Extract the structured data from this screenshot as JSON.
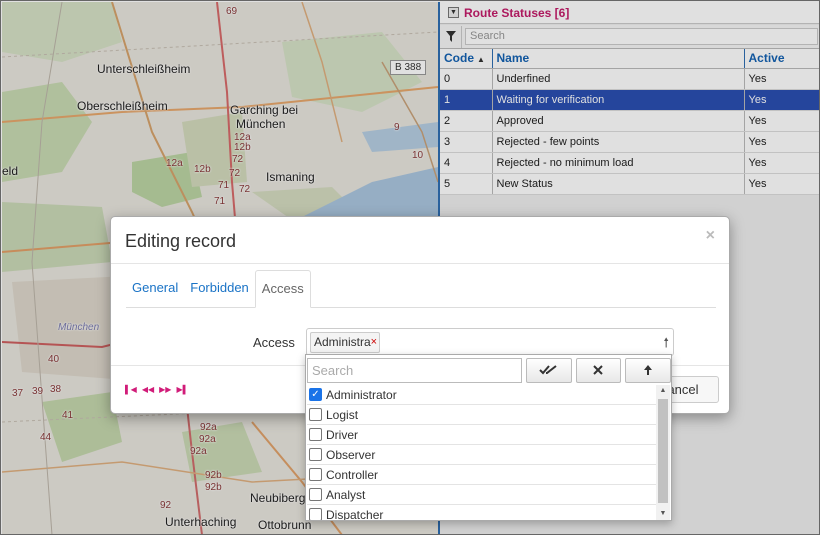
{
  "map": {
    "labels": {
      "unterschleissheim": "Unterschleißheim",
      "oberschleissheim": "Oberschleißheim",
      "garching": "Garching bei",
      "garching2": "München",
      "ismaning": "Ismaning",
      "eld": "eld",
      "muenchen": "München",
      "neubiberg": "Neubiberg",
      "unterhaching": "Unterhaching",
      "ottobrunn": "Ottobrunn"
    },
    "road_badge": "B 388",
    "road_numbers": [
      "69",
      "12a",
      "12b",
      "72",
      "72",
      "71",
      "71",
      "12a",
      "12b",
      "72",
      "37",
      "39",
      "40",
      "38",
      "41",
      "44",
      "92a",
      "92a",
      "92b",
      "92b",
      "92a",
      "92",
      "9",
      "10"
    ]
  },
  "panel": {
    "title": "Route Statuses [6]",
    "search_placeholder": "Search",
    "columns": [
      "Code",
      "Name",
      "Active"
    ],
    "rows": [
      {
        "code": "0",
        "name": "Underfined",
        "active": "Yes"
      },
      {
        "code": "1",
        "name": "Waiting for verification",
        "active": "Yes",
        "selected": true
      },
      {
        "code": "2",
        "name": "Approved",
        "active": "Yes"
      },
      {
        "code": "3",
        "name": "Rejected - few points",
        "active": "Yes"
      },
      {
        "code": "4",
        "name": "Rejected - no minimum load",
        "active": "Yes"
      },
      {
        "code": "5",
        "name": "New Status",
        "active": "Yes"
      }
    ]
  },
  "modal": {
    "title": "Editing record",
    "close": "×",
    "tabs": [
      "General",
      "Forbidden",
      "Access"
    ],
    "active_tab": "Access",
    "field_label": "Access",
    "selected_tag": "Administra",
    "tag_remove": "×",
    "cancel_label": "ancel",
    "pager": [
      "▶▌",
      "◀◀",
      "▶▶",
      "▶▌"
    ]
  },
  "dropdown": {
    "search_placeholder": "Search",
    "buttons": [
      "select-all",
      "clear",
      "collapse"
    ],
    "items": [
      {
        "label": "Administrator",
        "checked": true
      },
      {
        "label": "Logist",
        "checked": false
      },
      {
        "label": "Driver",
        "checked": false
      },
      {
        "label": "Observer",
        "checked": false
      },
      {
        "label": "Controller",
        "checked": false
      },
      {
        "label": "Analyst",
        "checked": false
      },
      {
        "label": "Dispatcher",
        "checked": false
      }
    ]
  },
  "colors": {
    "accent_pink": "#c41c6a",
    "header_blue": "#1462b3",
    "selected_row": "#2b4fb2",
    "link_blue": "#1a73c6"
  }
}
